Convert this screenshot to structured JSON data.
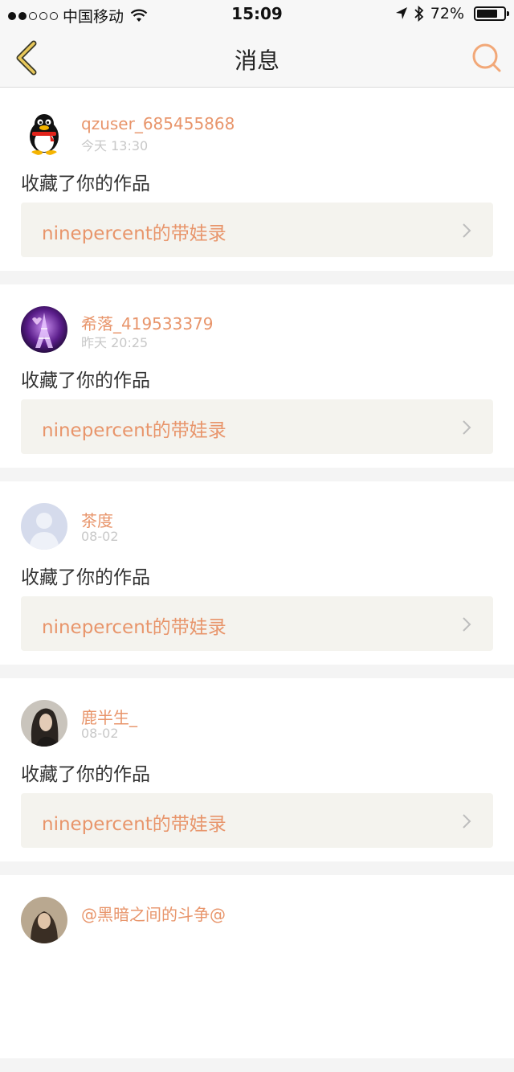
{
  "status_bar": {
    "carrier": "中国移动",
    "time": "15:09",
    "battery": "72%",
    "battery_level": 0.72
  },
  "nav": {
    "title": "消息",
    "back_icon": "chevron-left-icon",
    "search_icon": "search-icon",
    "accent_color": "#e8956b"
  },
  "messages": [
    {
      "username": "qzuser_685455868",
      "time": "今天 13:30",
      "action": "收藏了你的作品",
      "work_title": "ninepercent的带娃录",
      "avatar": "qq-penguin-avatar"
    },
    {
      "username": "希落_419533379",
      "time": "昨天 20:25",
      "action": "收藏了你的作品",
      "work_title": "ninepercent的带娃录",
      "avatar": "eiffel-tower-avatar"
    },
    {
      "username": "茶度",
      "time": "08-02",
      "action": "收藏了你的作品",
      "work_title": "ninepercent的带娃录",
      "avatar": "default-person-avatar"
    },
    {
      "username": "鹿半生_",
      "time": "08-02",
      "action": "收藏了你的作品",
      "work_title": "ninepercent的带娃录",
      "avatar": "woman-photo-avatar"
    },
    {
      "username": "@黑暗之间的斗争@",
      "avatar": "photo-avatar"
    }
  ]
}
